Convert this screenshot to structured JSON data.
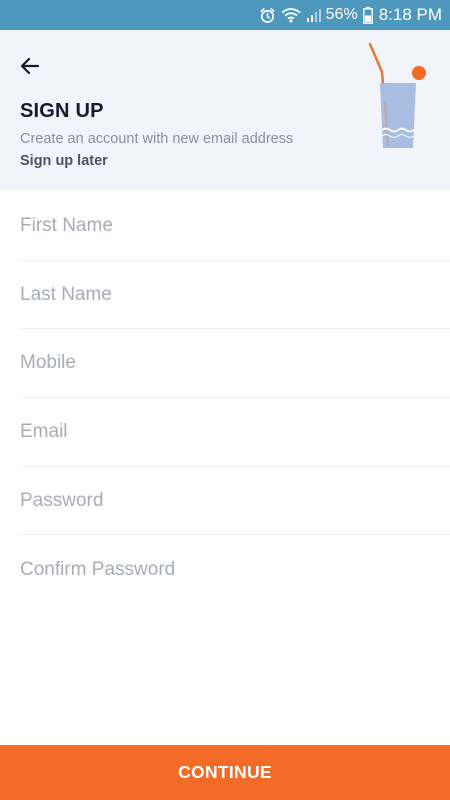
{
  "status_bar": {
    "battery_pct": "56%",
    "time": "8:18 PM",
    "icons": [
      "alarm-icon",
      "wifi-icon",
      "signal-icon",
      "battery-icon"
    ]
  },
  "header": {
    "back_icon": "arrow-left-icon",
    "title": "SIGN UP",
    "subtitle": "Create an account with new email address",
    "skip_link": "Sign up later",
    "illustration": "drink-glass-icon"
  },
  "form": {
    "first_name": {
      "placeholder": "First Name",
      "value": ""
    },
    "last_name": {
      "placeholder": "Last Name",
      "value": ""
    },
    "mobile": {
      "placeholder": "Mobile",
      "value": ""
    },
    "email": {
      "placeholder": "Email",
      "value": ""
    },
    "password": {
      "placeholder": "Password",
      "value": ""
    },
    "confirm_password": {
      "placeholder": "Confirm Password",
      "value": ""
    }
  },
  "actions": {
    "continue_label": "CONTINUE"
  },
  "colors": {
    "status_bar": "#4f98bd",
    "header_bg": "#f1f4fb",
    "accent": "#f36b26",
    "glass": "#a9bde3"
  }
}
